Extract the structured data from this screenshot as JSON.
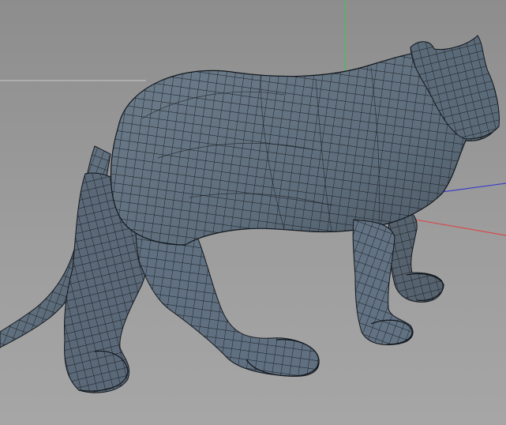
{
  "scene": {
    "model": "panther-quad-wireframe",
    "colors": {
      "background": "#999999",
      "mesh_fill": "#647382",
      "mesh_fill_dark": "#4d5a67",
      "mesh_wire": "#11161c",
      "x_axis": "#d84a4a",
      "y_axis": "#40c060",
      "z_axis": "#3c3cc8",
      "grid_line": "#c8c8c8"
    },
    "axes": [
      "x-axis",
      "y-axis",
      "z-axis"
    ],
    "grid": true
  }
}
